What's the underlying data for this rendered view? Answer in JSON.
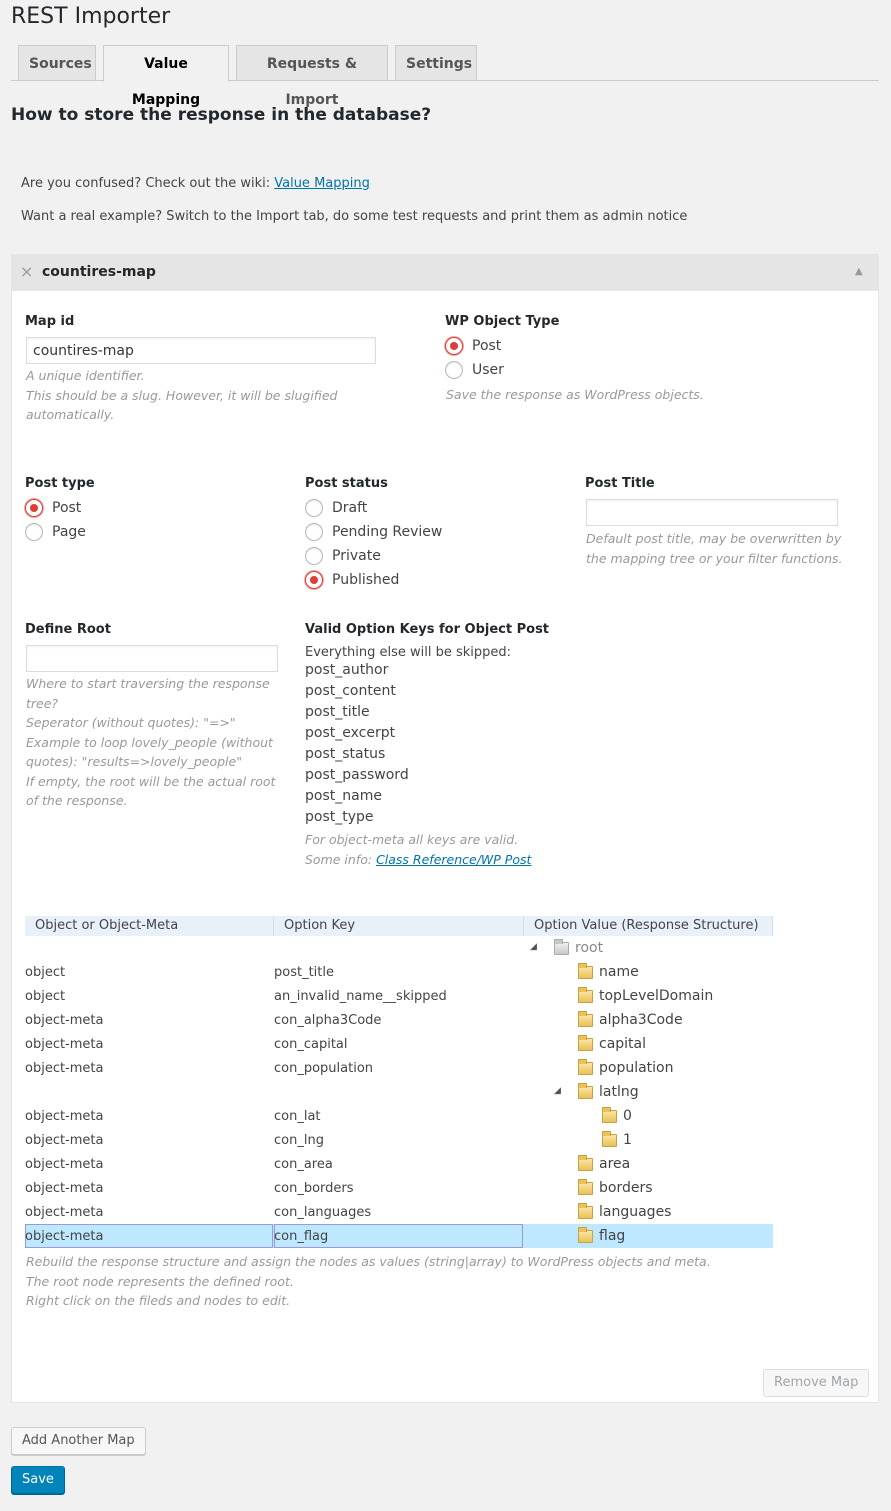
{
  "app": {
    "title": "REST Importer"
  },
  "tabs": [
    {
      "label": "Sources",
      "active": false
    },
    {
      "label": "Value Mapping",
      "active": true
    },
    {
      "label": "Requests & Import",
      "active": false
    },
    {
      "label": "Settings",
      "active": false
    }
  ],
  "heading": "How to store the response in the database?",
  "info": {
    "confused_text": "Are you confused? Check out the wiki:",
    "wiki_link": "Value Mapping",
    "example_text": "Want a real example? Switch to the Import tab, do some test requests and print them as admin notice"
  },
  "map_panel": {
    "close_icon": "×",
    "title": "countires-map",
    "toggle_icon": "▲",
    "map_id": {
      "label": "Map id",
      "value": "countires-map",
      "desc": [
        "A unique identifier.",
        "This should be a slug. However, it will be slugified",
        "automatically."
      ]
    },
    "object_type": {
      "label": "WP Object Type",
      "options": [
        "Post",
        "User"
      ],
      "selected": "Post",
      "desc": "Save the response as WordPress objects."
    },
    "post_type": {
      "label": "Post type",
      "options": [
        "Post",
        "Page"
      ],
      "selected": "Post"
    },
    "post_status": {
      "label": "Post status",
      "options": [
        "Draft",
        "Pending Review",
        "Private",
        "Published"
      ],
      "selected": "Published"
    },
    "post_title": {
      "label": "Post Title",
      "value": "",
      "desc": [
        "Default post title, may be overwritten by",
        "the mapping tree or your filter functions."
      ]
    },
    "define_root": {
      "label": "Define Root",
      "value": "",
      "desc": [
        "Where to start traversing the response",
        "tree?",
        "Seperator (without quotes): \"=>\"",
        "Example to loop lovely_people (without",
        "quotes): \"results=>lovely_people\"",
        "If empty, the root will be the actual root",
        "of the response."
      ]
    },
    "valid_keys": {
      "label": "Valid Option Keys for Object Post",
      "intro": "Everything else will be skipped:",
      "keys": [
        "post_author",
        "post_content",
        "post_title",
        "post_excerpt",
        "post_status",
        "post_password",
        "post_name",
        "post_type"
      ],
      "desc1": "For object-meta all keys are valid.",
      "desc2": "Some info:",
      "link": "Class Reference/WP Post"
    },
    "mapping_table": {
      "headers": [
        "Object or Object-Meta",
        "Option Key",
        "Option Value (Response Structure)"
      ],
      "root_label": "root",
      "rows": [
        {
          "type": "object",
          "key": "post_title",
          "node": "name"
        },
        {
          "type": "object",
          "key": "an_invalid_name__skipped",
          "node": "topLevelDomain"
        },
        {
          "type": "object-meta",
          "key": "con_alpha3Code",
          "node": "alpha3Code"
        },
        {
          "type": "object-meta",
          "key": "con_capital",
          "node": "capital"
        },
        {
          "type": "object-meta",
          "key": "con_population",
          "node": "population"
        },
        {
          "type": "",
          "key": "",
          "node": "latlng"
        },
        {
          "type": "object-meta",
          "key": "con_lat",
          "node": "0"
        },
        {
          "type": "object-meta",
          "key": "con_lng",
          "node": "1"
        },
        {
          "type": "object-meta",
          "key": "con_area",
          "node": "area"
        },
        {
          "type": "object-meta",
          "key": "con_borders",
          "node": "borders"
        },
        {
          "type": "object-meta",
          "key": "con_languages",
          "node": "languages"
        },
        {
          "type": "object-meta",
          "key": "con_flag",
          "node": "flag"
        }
      ],
      "desc": [
        "Rebuild the response structure and assign the nodes as values (string|array) to WordPress objects and meta.",
        "The root node represents the defined root.",
        "Right click on the fileds and nodes to edit."
      ]
    },
    "remove_button": "Remove Map"
  },
  "add_button": "Add Another Map",
  "save_button": "Save",
  "colors": {
    "accent": "#0085ba",
    "radio_checked": "#dd3d36",
    "selected_row": "#bde8ff"
  }
}
